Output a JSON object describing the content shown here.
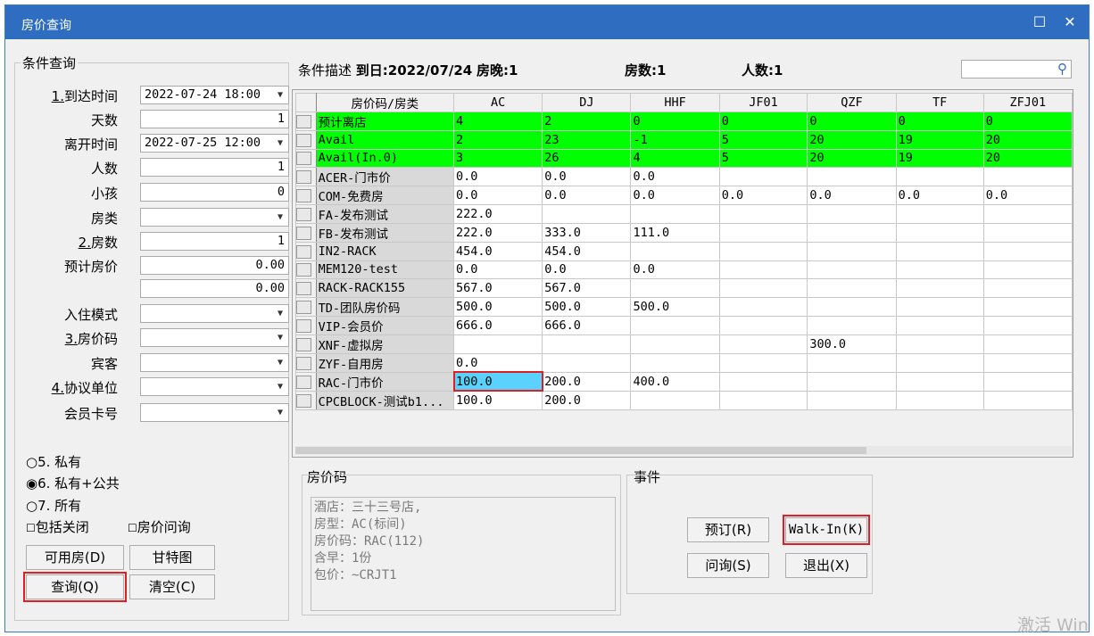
{
  "window": {
    "title": "房价查询"
  },
  "condition": {
    "group_label": "条件查询",
    "arrive_label_num": "1.",
    "arrive_label": "到达时间",
    "arrive_value": "2022-07-24 18:00",
    "days_label": "天数",
    "days_value": "1",
    "leave_label": "离开时间",
    "leave_value": "2022-07-25 12:00",
    "persons_label": "人数",
    "persons_value": "1",
    "kids_label": "小孩",
    "kids_value": "0",
    "roomtype_label": "房类",
    "roomtype_value": "",
    "rooms_label_num": "2.",
    "rooms_label": "房数",
    "rooms_value": "1",
    "est_price_label": "预计房价",
    "est_price_value": "0.00",
    "est_price_value2": "0.00",
    "checkin_mode_label": "入住模式",
    "ratecode_label_num": "3.",
    "ratecode_label": "房价码",
    "guest_label": "宾客",
    "agreement_label_num": "4.",
    "agreement_label": "协议单位",
    "member_label": "会员卡号",
    "radio_private": "5. 私有",
    "radio_private_public": "6. 私有+公共",
    "radio_all": "7. 所有",
    "chk_include_closed": "包括关闭",
    "chk_rate_inquiry": "房价问询",
    "btn_available": "可用房(D)",
    "btn_gantt": "甘特图",
    "btn_query": "查询(Q)",
    "btn_clear": "清空(C)"
  },
  "summary": {
    "prefix": "条件描述",
    "arrival": "到日:2022/07/24",
    "nights": "房晚:1",
    "rooms": "房数:1",
    "persons": "人数:1",
    "search_placeholder": ""
  },
  "grid": {
    "header_first": "房价码/房类",
    "columns": [
      "AC",
      "DJ",
      "HHF",
      "JF01",
      "QZF",
      "TF",
      "ZFJ01"
    ],
    "rows": [
      {
        "name": "预计离店",
        "green": true,
        "cells": [
          "4",
          "2",
          "0",
          "0",
          "0",
          "0",
          "0"
        ]
      },
      {
        "name": "Avail",
        "green": true,
        "cells": [
          "2",
          "23",
          "-1",
          "5",
          "20",
          "19",
          "20"
        ]
      },
      {
        "name": "Avail(In.0)",
        "green": true,
        "cells": [
          "3",
          "26",
          "4",
          "5",
          "20",
          "19",
          "20"
        ]
      },
      {
        "name": "ACER-门市价",
        "green": false,
        "cells": [
          "0.0",
          "0.0",
          "0.0",
          "",
          "",
          "",
          ""
        ]
      },
      {
        "name": "COM-免费房",
        "green": false,
        "cells": [
          "0.0",
          "0.0",
          "0.0",
          "0.0",
          "0.0",
          "0.0",
          "0.0"
        ]
      },
      {
        "name": "FA-发布测试",
        "green": false,
        "cells": [
          "222.0",
          "",
          "",
          "",
          "",
          "",
          ""
        ]
      },
      {
        "name": "FB-发布测试",
        "green": false,
        "cells": [
          "222.0",
          "333.0",
          "111.0",
          "",
          "",
          "",
          ""
        ]
      },
      {
        "name": "IN2-RACK",
        "green": false,
        "cells": [
          "454.0",
          "454.0",
          "",
          "",
          "",
          "",
          ""
        ]
      },
      {
        "name": "MEM120-test",
        "green": false,
        "cells": [
          "0.0",
          "0.0",
          "0.0",
          "",
          "",
          "",
          ""
        ]
      },
      {
        "name": "RACK-RACK155",
        "green": false,
        "cells": [
          "567.0",
          "567.0",
          "",
          "",
          "",
          "",
          ""
        ]
      },
      {
        "name": "TD-团队房价码",
        "green": false,
        "cells": [
          "500.0",
          "500.0",
          "500.0",
          "",
          "",
          "",
          ""
        ]
      },
      {
        "name": "VIP-会员价",
        "green": false,
        "cells": [
          "666.0",
          "666.0",
          "",
          "",
          "",
          "",
          ""
        ]
      },
      {
        "name": "XNF-虚拟房",
        "green": false,
        "cells": [
          "",
          "",
          "",
          "",
          "300.0",
          "",
          ""
        ]
      },
      {
        "name": "ZYF-自用房",
        "green": false,
        "cells": [
          "0.0",
          "",
          "",
          "",
          "",
          "",
          ""
        ]
      },
      {
        "name": "RAC-门市价",
        "green": false,
        "cells": [
          "100.0",
          "200.0",
          "400.0",
          "",
          "",
          "",
          ""
        ],
        "selected_col": 0
      },
      {
        "name": "CPCBLOCK-测试b1...",
        "green": false,
        "cells": [
          "100.0",
          "200.0",
          "",
          "",
          "",
          "",
          ""
        ]
      }
    ]
  },
  "ratecode_panel": {
    "label": "房价码",
    "lines": [
      "酒店：三十三号店,",
      "房型：AC(标间)",
      "房价码：RAC(112)",
      "含早：1份",
      "包价：~CRJT1"
    ]
  },
  "events": {
    "label": "事件",
    "btn_book": "预订(R)",
    "btn_walkin": "Walk-In(K)",
    "btn_inquiry": "问询(S)",
    "btn_exit": "退出(X)"
  },
  "watermark": "激活 Win"
}
